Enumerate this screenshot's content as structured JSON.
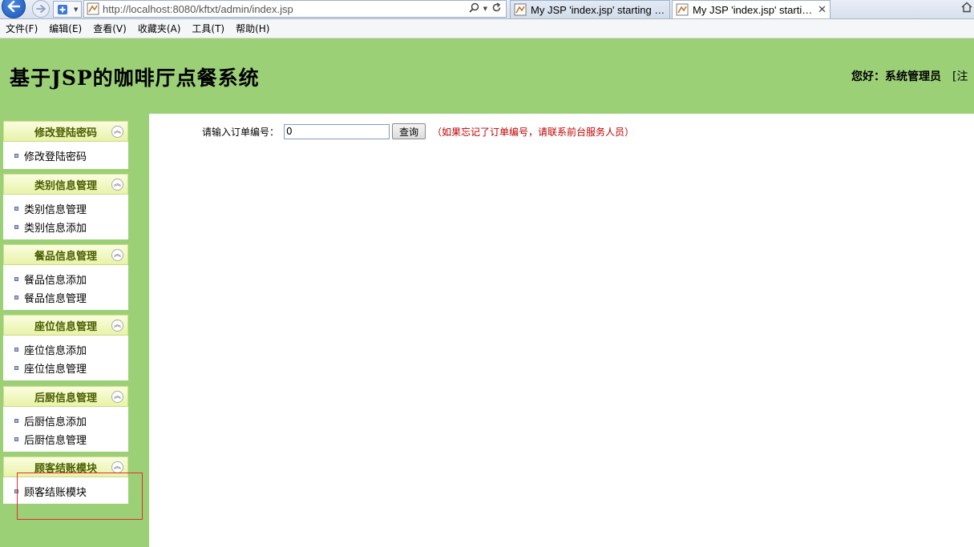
{
  "browser": {
    "url": "http://localhost:8080/kftxt/admin/index.jsp",
    "tabs": [
      {
        "title": "My JSP 'index.jsp' starting p..."
      },
      {
        "title": "My JSP 'index.jsp' startin...",
        "close": "✕"
      }
    ]
  },
  "menubar": {
    "items": [
      "文件(F)",
      "编辑(E)",
      "查看(V)",
      "收藏夹(A)",
      "工具(T)",
      "帮助(H)"
    ]
  },
  "header": {
    "title": "基于JSP的咖啡厅点餐系统",
    "welcome": "您好：系统管理员",
    "logout_fragment": "[注"
  },
  "sidebar": {
    "groups": [
      {
        "title": "修改登陆密码",
        "items": [
          "修改登陆密码"
        ]
      },
      {
        "title": "类别信息管理",
        "items": [
          "类别信息管理",
          "类别信息添加"
        ]
      },
      {
        "title": "餐品信息管理",
        "items": [
          "餐品信息添加",
          "餐品信息管理"
        ]
      },
      {
        "title": "座位信息管理",
        "items": [
          "座位信息添加",
          "座位信息管理"
        ]
      },
      {
        "title": "后厨信息管理",
        "items": [
          "后厨信息添加",
          "后厨信息管理"
        ]
      },
      {
        "title": "顾客结账模块",
        "items": [
          "顾客结账模块"
        ]
      }
    ]
  },
  "main": {
    "query_label": "请输入订单编号：",
    "order_value": "0",
    "query_button": "查询",
    "hint": "（如果忘记了订单编号，请联系前台服务人员）"
  },
  "colors": {
    "header_bg": "#9cd077",
    "hint_red": "#c00000",
    "group_title": "#4a5d00"
  }
}
